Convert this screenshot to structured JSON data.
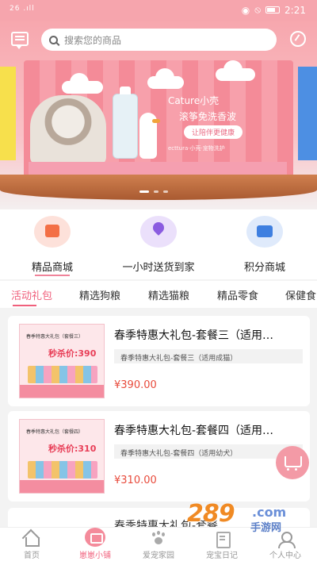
{
  "status_bar": {
    "signal": "26 .ıll",
    "time": "2:21"
  },
  "header": {
    "search_placeholder": "搜索您的商品"
  },
  "banner": {
    "title": "Cature小壳",
    "subtitle": "滚筝免洗香波",
    "pill": "让陪伴更健康",
    "small_text": "ecttura·小壳·宠物洗护"
  },
  "quick_menu": [
    {
      "label": "精品商城",
      "icon": "gift-bag-icon"
    },
    {
      "label": "一小时送货到家",
      "icon": "location-pin-icon"
    },
    {
      "label": "积分商城",
      "icon": "basket-icon"
    }
  ],
  "category_tabs": [
    "活动礼包",
    "精选狗粮",
    "精选猫粮",
    "精品零食",
    "保健食"
  ],
  "active_category": "活动礼包",
  "products": [
    {
      "title": "春季特惠大礼包-套餐三（适用…",
      "tag": "春季特惠大礼包-套餐三（适用成猫）",
      "price": "¥390.00",
      "thumb_title": "春季特惠大礼包（套餐三）",
      "thumb_price": "秒杀价:390"
    },
    {
      "title": "春季特惠大礼包-套餐四（适用…",
      "tag": "春季特惠大礼包-套餐四（适用幼犬）",
      "price": "¥310.00",
      "thumb_title": "春季特惠大礼包（套餐四）",
      "thumb_price": "秒杀价:310"
    },
    {
      "title": "春季特惠大礼包-套餐…"
    }
  ],
  "tabbar": [
    {
      "label": "首页",
      "icon": "home-icon"
    },
    {
      "label": "崽崽小铺",
      "icon": "shop-icon"
    },
    {
      "label": "爱宠家园",
      "icon": "paw-icon"
    },
    {
      "label": "宠宝日记",
      "icon": "diary-icon"
    },
    {
      "label": "个人中心",
      "icon": "user-icon"
    }
  ],
  "active_tab": "崽崽小铺",
  "watermark": {
    "number": "289",
    "domain": ".com",
    "caption": "手游网"
  },
  "colors": {
    "accent": "#f0607c",
    "header_pink": "#f7a7ae",
    "price": "#e84b3c"
  }
}
